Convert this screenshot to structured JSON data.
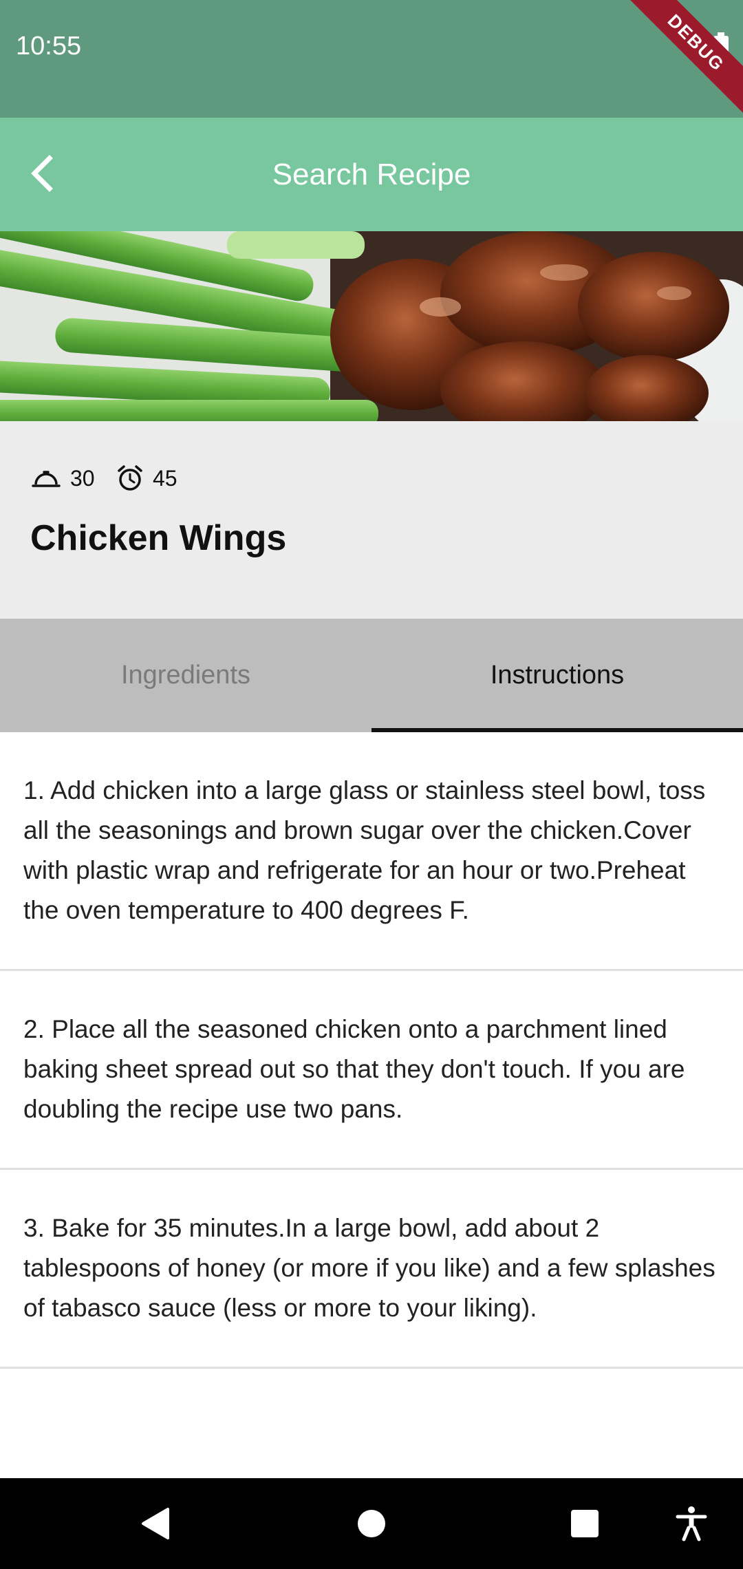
{
  "status_bar": {
    "time": "10:55",
    "debug_label": "DEBUG",
    "color": "#5f9a7e"
  },
  "app_bar": {
    "title": "Search Recipe",
    "color": "#78c79f"
  },
  "recipe": {
    "servings": "30",
    "minutes": "45",
    "title": "Chicken Wings"
  },
  "tabs": [
    {
      "label": "Ingredients",
      "selected": false
    },
    {
      "label": "Instructions",
      "selected": true
    }
  ],
  "instructions": [
    "1. Add chicken into a large glass or stainless steel bowl, toss all the seasonings and brown sugar over the chicken.Cover with plastic wrap and refrigerate for an hour or two.Preheat the oven temperature to 400 degrees F.",
    "2. Place all the seasoned chicken onto a parchment lined baking sheet spread out so that they don't touch.  If you are doubling the recipe use two pans.",
    "3. Bake for 35 minutes.In a large bowl, add about 2 tablespoons of honey (or more if you like) and a few splashes of tabasco sauce (less or more to your liking)."
  ],
  "icons": {
    "back": "arrow-back-icon",
    "servings": "room-service-icon",
    "time": "alarm-icon"
  }
}
